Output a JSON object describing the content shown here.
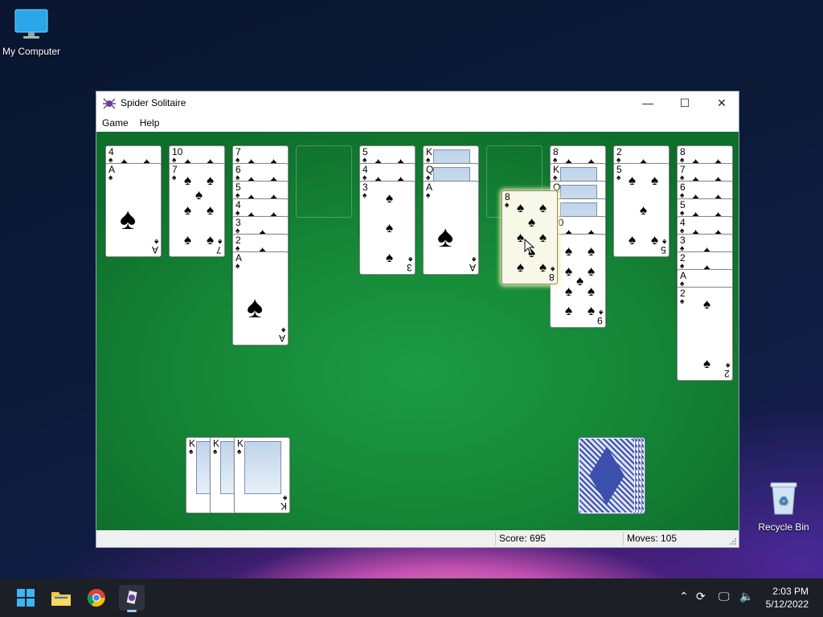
{
  "desktop": {
    "my_computer": "My Computer",
    "recycle_bin": "Recycle Bin"
  },
  "window": {
    "title": "Spider Solitaire",
    "menu": [
      "Game",
      "Help"
    ],
    "controls": {
      "minimize": "—",
      "maximize": "☐",
      "close": "✕"
    }
  },
  "game": {
    "felt_color": "#168a38",
    "columns": [
      [
        "4♠",
        "A♠"
      ],
      [
        "10♠",
        "7♠"
      ],
      [
        "7♠",
        "6♠",
        "5♠",
        "4♠",
        "3♠",
        "2♠",
        "A♠"
      ],
      [],
      [
        "5♠",
        "4♠",
        "3♠"
      ],
      [
        "K♠",
        "Q♠",
        "A♠"
      ],
      [],
      [
        "8♠",
        "K♠",
        "Q♠",
        "J♠",
        "10♠",
        "9♠"
      ],
      [
        "2♠",
        "5♠"
      ],
      [
        "8♠",
        "7♠",
        "6♠",
        "5♠",
        "4♠",
        "3♠",
        "2♠",
        "A♠",
        "2♠"
      ]
    ],
    "dragging_card": "8♠",
    "completed_suits": [
      "K♠",
      "K♠",
      "K♠"
    ],
    "stock_piles": 4
  },
  "status": {
    "score": "Score: 695",
    "moves": "Moves:  105"
  },
  "taskbar": {
    "time": "2:03 PM",
    "date": "5/12/2022"
  }
}
